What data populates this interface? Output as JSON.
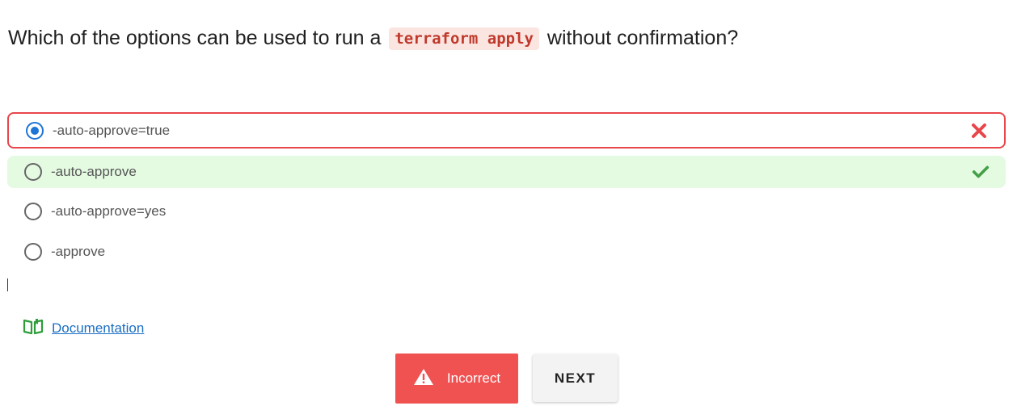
{
  "question": {
    "before": "Which of the options can be used to run a ",
    "code": "terraform apply",
    "after": " without confirmation?"
  },
  "options": [
    {
      "label": "-auto-approve=true",
      "selected": true,
      "state": "wrong",
      "icon": "close-icon",
      "color": "#e8464a"
    },
    {
      "label": "-auto-approve",
      "selected": false,
      "state": "correct",
      "icon": "check-icon",
      "color": "#43a047"
    },
    {
      "label": "-auto-approve=yes",
      "selected": false,
      "state": "neutral"
    },
    {
      "label": "-approve",
      "selected": false,
      "state": "neutral"
    }
  ],
  "documentation": {
    "label": "Documentation",
    "icon": "book-icon",
    "icon_color": "#2e9d3a"
  },
  "result_button": {
    "label": "Incorrect",
    "icon": "warning-icon",
    "color": "#f05252"
  },
  "next_button": {
    "label": "NEXT"
  }
}
